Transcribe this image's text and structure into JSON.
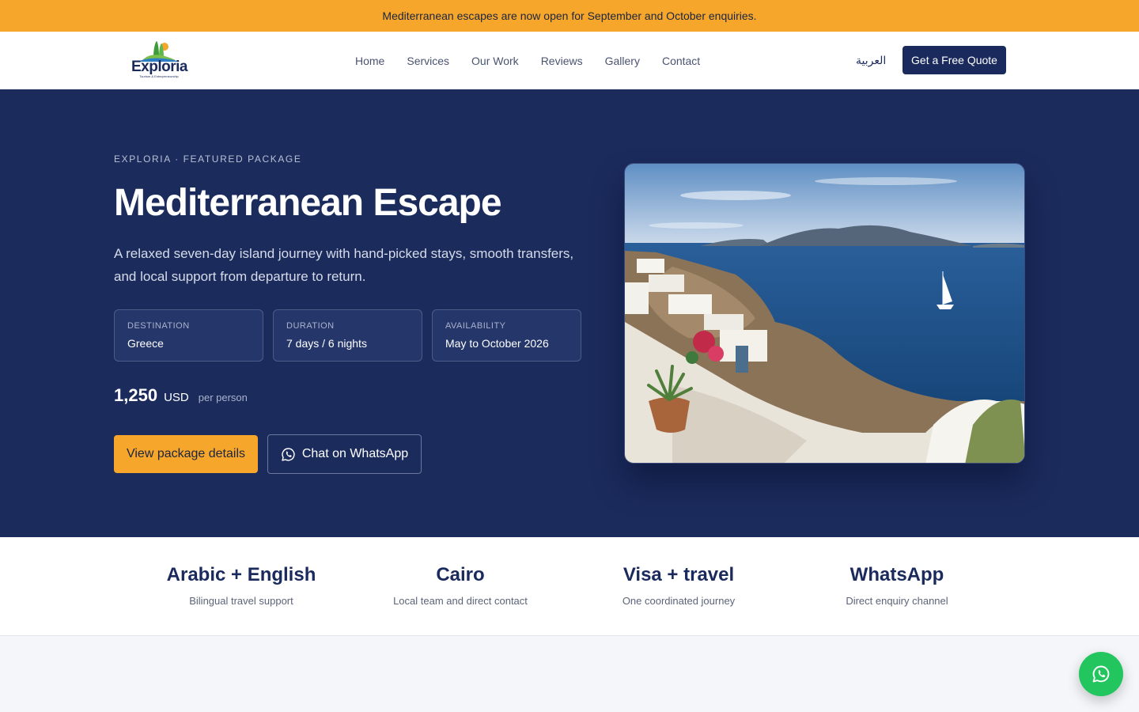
{
  "announcement": "Mediterranean escapes are now open for September and October enquiries.",
  "brand": {
    "name": "Exploria",
    "tagline": "Tourism & Entrepreneurship"
  },
  "nav": {
    "items": [
      "Home",
      "Services",
      "Our Work",
      "Reviews",
      "Gallery",
      "Contact"
    ]
  },
  "header": {
    "language": "العربية",
    "cta": "Get a Free Quote"
  },
  "hero": {
    "eyebrow": "EXPLORIA · FEATURED PACKAGE",
    "title": "Mediterranean Escape",
    "description": "A relaxed seven-day island journey with hand-picked stays, smooth transfers, and local support from departure to return.",
    "facts": [
      {
        "label": "DESTINATION",
        "value": "Greece"
      },
      {
        "label": "DURATION",
        "value": "7 days / 6 nights"
      },
      {
        "label": "AVAILABILITY",
        "value": "May to October 2026"
      }
    ],
    "price": {
      "amount": "1,250",
      "currency": "USD",
      "unit": "per person"
    },
    "primary_cta": "View package details",
    "secondary_cta": "Chat on WhatsApp"
  },
  "stats": [
    {
      "title": "Arabic + English",
      "subtitle": "Bilingual travel support"
    },
    {
      "title": "Cairo",
      "subtitle": "Local team and direct contact"
    },
    {
      "title": "Visa + travel",
      "subtitle": "One coordinated journey"
    },
    {
      "title": "WhatsApp",
      "subtitle": "Direct enquiry channel"
    }
  ],
  "colors": {
    "accent": "#f5a62b",
    "navy": "#1b2b5c",
    "whatsapp": "#22c55e"
  },
  "icons": {
    "whatsapp": "whatsapp-icon",
    "logo": "exploria-logo"
  }
}
